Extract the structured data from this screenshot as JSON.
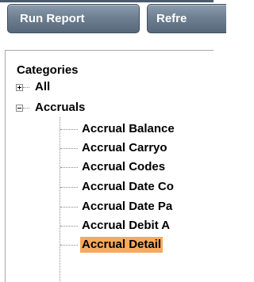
{
  "toolbar": {
    "run_report_label": "Run Report",
    "refresh_label": "Refre"
  },
  "panel": {
    "title": "Categories",
    "tree": {
      "all": {
        "label": "All",
        "state": "collapsed"
      },
      "accruals": {
        "label": "Accruals",
        "state": "expanded",
        "children": [
          {
            "label": "Accrual Balance",
            "selected": false
          },
          {
            "label": "Accrual Carryo",
            "selected": false
          },
          {
            "label": "Accrual Codes",
            "selected": false
          },
          {
            "label": "Accrual Date Co",
            "selected": false
          },
          {
            "label": "Accrual Date Pa",
            "selected": false
          },
          {
            "label": "Accrual Debit A",
            "selected": false
          },
          {
            "label": "Accrual Detail",
            "selected": true
          }
        ]
      }
    }
  },
  "colors": {
    "button_top": "#8c9cad",
    "button_bottom": "#566879",
    "selection": "#f7a95c"
  }
}
